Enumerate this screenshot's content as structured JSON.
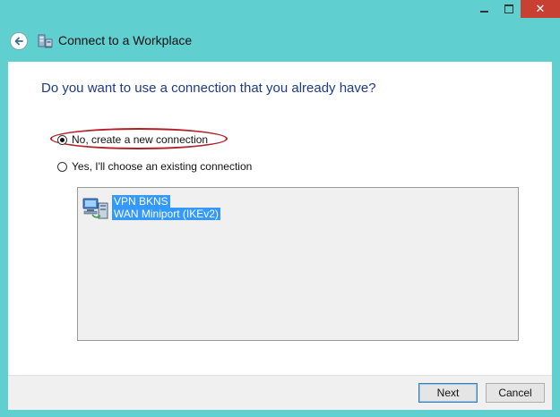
{
  "window": {
    "title": "Connect to a Workplace",
    "controls": {
      "minimize_icon": "minimize-icon",
      "maximize_icon": "maximize-icon",
      "close_label": "✕"
    }
  },
  "page": {
    "question": "Do you want to use a connection that you already have?",
    "options": [
      {
        "label": "No, create a new connection",
        "selected": true
      },
      {
        "label": "Yes, I'll choose an existing connection",
        "selected": false
      }
    ],
    "connections": [
      {
        "name": "VPN BKNS",
        "device": "WAN Miniport (IKEv2)",
        "selected": true
      }
    ]
  },
  "footer": {
    "next_label": "Next",
    "cancel_label": "Cancel"
  },
  "colors": {
    "frame": "#5fcfd0",
    "heading": "#1e3a8a",
    "highlight_ellipse": "#b02026",
    "selection": "#3399ff",
    "close_button": "#c84031"
  }
}
